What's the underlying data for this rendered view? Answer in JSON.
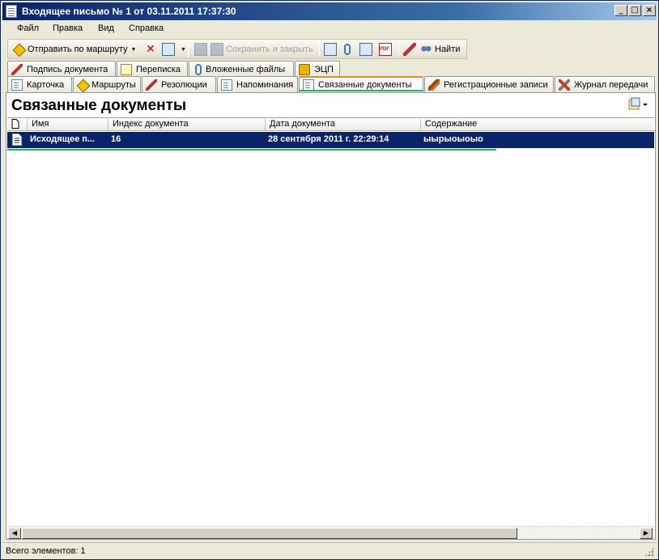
{
  "window": {
    "title": "Входящее письмо № 1 от 03.11.2011 17:37:30",
    "controls": {
      "minimize": "_",
      "maximize": "□",
      "close": "×"
    }
  },
  "menu": [
    "Файл",
    "Правка",
    "Вид",
    "Справка"
  ],
  "toolbar": {
    "send_route": "Отправить по маршруту",
    "save_close": "Сохранить и закрыть",
    "find": "Найти"
  },
  "tabs_row1": [
    {
      "label": "Подпись документа",
      "icon": "pen-icon"
    },
    {
      "label": "Переписка",
      "icon": "envelope-icon"
    },
    {
      "label": "Вложенные файлы",
      "icon": "paperclip-icon"
    },
    {
      "label": "ЭЦП",
      "icon": "lock-icon"
    }
  ],
  "tabs_row2": [
    {
      "label": "Карточка",
      "icon": "card-icon"
    },
    {
      "label": "Маршруты",
      "icon": "route-icon"
    },
    {
      "label": "Резолюции",
      "icon": "resolution-icon"
    },
    {
      "label": "Напоминания",
      "icon": "reminder-icon"
    },
    {
      "label": "Связанные документы",
      "icon": "linked-docs-icon"
    },
    {
      "label": "Регистрационные записи",
      "icon": "brush-icon"
    },
    {
      "label": "Журнал передачи",
      "icon": "tools-icon"
    }
  ],
  "panel": {
    "title": "Связанные документы",
    "columns": [
      "Имя",
      "Индекс документа",
      "Дата документа",
      "Содержание"
    ],
    "rows": [
      {
        "name": "Исходящее п...",
        "index": "16",
        "date": "28 сентября 2011 г. 22:29:14",
        "content": "ыырыоыоыо"
      }
    ]
  },
  "status": {
    "text": "Всего элементов: 1"
  },
  "colors": {
    "selection": "#0a246a",
    "active_tab_underline": "#2fae4b",
    "active_tab_top": "#e68b2c"
  }
}
